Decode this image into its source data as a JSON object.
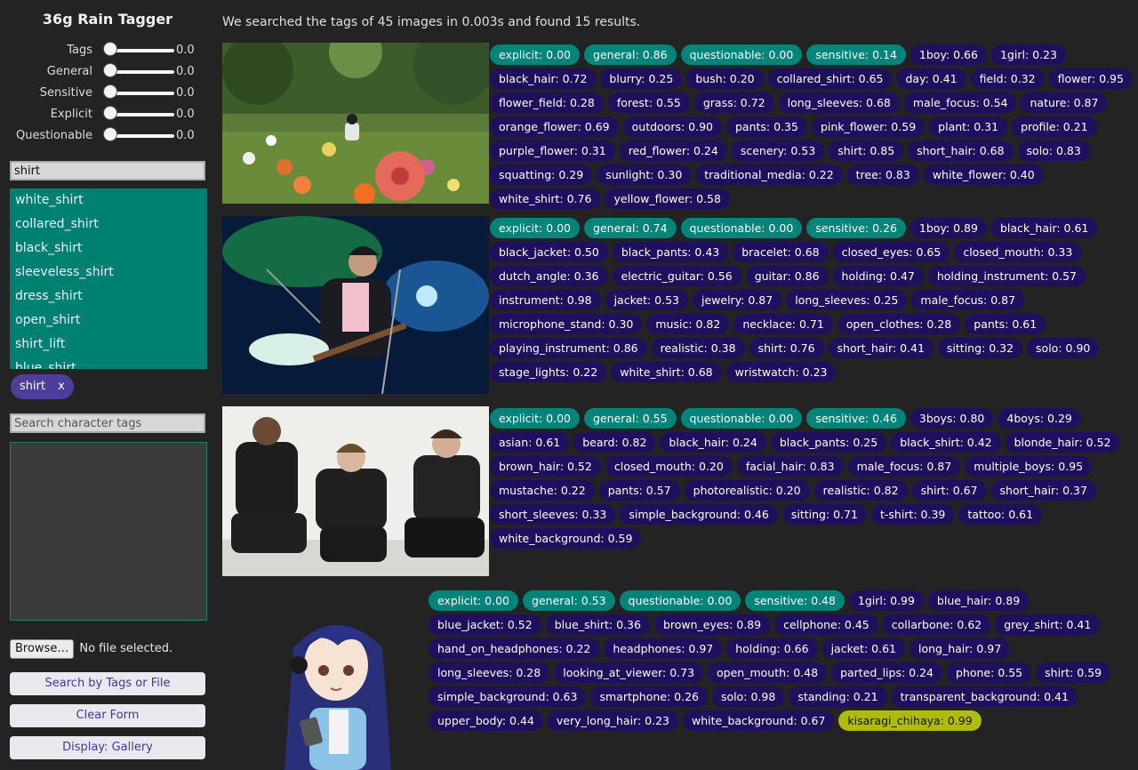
{
  "app": {
    "title": "36g Rain Tagger"
  },
  "sliders": [
    {
      "label": "Tags",
      "value": "0.0"
    },
    {
      "label": "General",
      "value": "0.0"
    },
    {
      "label": "Sensitive",
      "value": "0.0"
    },
    {
      "label": "Explicit",
      "value": "0.0"
    },
    {
      "label": "Questionable",
      "value": "0.0"
    }
  ],
  "search": {
    "value": "shirt"
  },
  "suggestions": [
    "white_shirt",
    "collared_shirt",
    "black_shirt",
    "sleeveless_shirt",
    "dress_shirt",
    "open_shirt",
    "shirt_lift",
    "blue_shirt"
  ],
  "selected_tags": [
    {
      "label": "shirt",
      "remove": "x"
    }
  ],
  "character_search": {
    "placeholder": "Search character tags"
  },
  "file": {
    "button": "Browse…",
    "status": "No file selected."
  },
  "buttons": {
    "search": "Search by Tags or File",
    "clear": "Clear Form",
    "display": "Display: Gallery"
  },
  "results_summary": "We searched the tags of 45 images in 0.003s and found 15 results.",
  "colors": {
    "rating_tag": "#01857a",
    "general_tag": "#1f0f5e",
    "character_tag": "#afbb05",
    "suggest_bg": "#008070",
    "chip_bg": "#4e3d9a"
  },
  "results": [
    {
      "image": "anime-flower-field-scene",
      "tags": [
        {
          "t": "explicit: 0.00",
          "k": "rating"
        },
        {
          "t": "general: 0.86",
          "k": "rating"
        },
        {
          "t": "questionable: 0.00",
          "k": "rating"
        },
        {
          "t": "sensitive: 0.14",
          "k": "rating"
        },
        {
          "t": "1boy: 0.66",
          "k": "general"
        },
        {
          "t": "1girl: 0.23",
          "k": "general"
        },
        {
          "t": "black_hair: 0.72",
          "k": "general"
        },
        {
          "t": "blurry: 0.25",
          "k": "general"
        },
        {
          "t": "bush: 0.20",
          "k": "general"
        },
        {
          "t": "collared_shirt: 0.65",
          "k": "general"
        },
        {
          "t": "day: 0.41",
          "k": "general"
        },
        {
          "t": "field: 0.32",
          "k": "general"
        },
        {
          "t": "flower: 0.95",
          "k": "general"
        },
        {
          "t": "flower_field: 0.28",
          "k": "general"
        },
        {
          "t": "forest: 0.55",
          "k": "general"
        },
        {
          "t": "grass: 0.72",
          "k": "general"
        },
        {
          "t": "long_sleeves: 0.68",
          "k": "general"
        },
        {
          "t": "male_focus: 0.54",
          "k": "general"
        },
        {
          "t": "nature: 0.87",
          "k": "general"
        },
        {
          "t": "orange_flower: 0.69",
          "k": "general"
        },
        {
          "t": "outdoors: 0.90",
          "k": "general"
        },
        {
          "t": "pants: 0.35",
          "k": "general"
        },
        {
          "t": "pink_flower: 0.59",
          "k": "general"
        },
        {
          "t": "plant: 0.31",
          "k": "general"
        },
        {
          "t": "profile: 0.21",
          "k": "general"
        },
        {
          "t": "purple_flower: 0.31",
          "k": "general"
        },
        {
          "t": "red_flower: 0.24",
          "k": "general"
        },
        {
          "t": "scenery: 0.53",
          "k": "general"
        },
        {
          "t": "shirt: 0.85",
          "k": "general"
        },
        {
          "t": "short_hair: 0.68",
          "k": "general"
        },
        {
          "t": "solo: 0.83",
          "k": "general"
        },
        {
          "t": "squatting: 0.29",
          "k": "general"
        },
        {
          "t": "sunlight: 0.30",
          "k": "general"
        },
        {
          "t": "traditional_media: 0.22",
          "k": "general"
        },
        {
          "t": "tree: 0.83",
          "k": "general"
        },
        {
          "t": "white_flower: 0.40",
          "k": "general"
        },
        {
          "t": "white_shirt: 0.76",
          "k": "general"
        },
        {
          "t": "yellow_flower: 0.58",
          "k": "general"
        }
      ]
    },
    {
      "image": "guitarist-on-stage-photo",
      "tags": [
        {
          "t": "explicit: 0.00",
          "k": "rating"
        },
        {
          "t": "general: 0.74",
          "k": "rating"
        },
        {
          "t": "questionable: 0.00",
          "k": "rating"
        },
        {
          "t": "sensitive: 0.26",
          "k": "rating"
        },
        {
          "t": "1boy: 0.89",
          "k": "general"
        },
        {
          "t": "black_hair: 0.61",
          "k": "general"
        },
        {
          "t": "black_jacket: 0.50",
          "k": "general"
        },
        {
          "t": "black_pants: 0.43",
          "k": "general"
        },
        {
          "t": "bracelet: 0.68",
          "k": "general"
        },
        {
          "t": "closed_eyes: 0.65",
          "k": "general"
        },
        {
          "t": "closed_mouth: 0.33",
          "k": "general"
        },
        {
          "t": "dutch_angle: 0.36",
          "k": "general"
        },
        {
          "t": "electric_guitar: 0.56",
          "k": "general"
        },
        {
          "t": "guitar: 0.86",
          "k": "general"
        },
        {
          "t": "holding: 0.47",
          "k": "general"
        },
        {
          "t": "holding_instrument: 0.57",
          "k": "general"
        },
        {
          "t": "instrument: 0.98",
          "k": "general"
        },
        {
          "t": "jacket: 0.53",
          "k": "general"
        },
        {
          "t": "jewelry: 0.87",
          "k": "general"
        },
        {
          "t": "long_sleeves: 0.25",
          "k": "general"
        },
        {
          "t": "male_focus: 0.87",
          "k": "general"
        },
        {
          "t": "microphone_stand: 0.30",
          "k": "general"
        },
        {
          "t": "music: 0.82",
          "k": "general"
        },
        {
          "t": "necklace: 0.71",
          "k": "general"
        },
        {
          "t": "open_clothes: 0.28",
          "k": "general"
        },
        {
          "t": "pants: 0.61",
          "k": "general"
        },
        {
          "t": "playing_instrument: 0.86",
          "k": "general"
        },
        {
          "t": "realistic: 0.38",
          "k": "general"
        },
        {
          "t": "shirt: 0.76",
          "k": "general"
        },
        {
          "t": "short_hair: 0.41",
          "k": "general"
        },
        {
          "t": "sitting: 0.32",
          "k": "general"
        },
        {
          "t": "solo: 0.90",
          "k": "general"
        },
        {
          "t": "stage_lights: 0.22",
          "k": "general"
        },
        {
          "t": "white_shirt: 0.68",
          "k": "general"
        },
        {
          "t": "wristwatch: 0.23",
          "k": "general"
        }
      ]
    },
    {
      "image": "three-men-sitting-photo",
      "tags": [
        {
          "t": "explicit: 0.00",
          "k": "rating"
        },
        {
          "t": "general: 0.55",
          "k": "rating"
        },
        {
          "t": "questionable: 0.00",
          "k": "rating"
        },
        {
          "t": "sensitive: 0.46",
          "k": "rating"
        },
        {
          "t": "3boys: 0.80",
          "k": "general"
        },
        {
          "t": "4boys: 0.29",
          "k": "general"
        },
        {
          "t": "asian: 0.61",
          "k": "general"
        },
        {
          "t": "beard: 0.82",
          "k": "general"
        },
        {
          "t": "black_hair: 0.24",
          "k": "general"
        },
        {
          "t": "black_pants: 0.25",
          "k": "general"
        },
        {
          "t": "black_shirt: 0.42",
          "k": "general"
        },
        {
          "t": "blonde_hair: 0.52",
          "k": "general"
        },
        {
          "t": "brown_hair: 0.52",
          "k": "general"
        },
        {
          "t": "closed_mouth: 0.20",
          "k": "general"
        },
        {
          "t": "facial_hair: 0.83",
          "k": "general"
        },
        {
          "t": "male_focus: 0.87",
          "k": "general"
        },
        {
          "t": "multiple_boys: 0.95",
          "k": "general"
        },
        {
          "t": "mustache: 0.22",
          "k": "general"
        },
        {
          "t": "pants: 0.57",
          "k": "general"
        },
        {
          "t": "photorealistic: 0.20",
          "k": "general"
        },
        {
          "t": "realistic: 0.82",
          "k": "general"
        },
        {
          "t": "shirt: 0.67",
          "k": "general"
        },
        {
          "t": "short_hair: 0.37",
          "k": "general"
        },
        {
          "t": "short_sleeves: 0.33",
          "k": "general"
        },
        {
          "t": "simple_background: 0.46",
          "k": "general"
        },
        {
          "t": "sitting: 0.71",
          "k": "general"
        },
        {
          "t": "t-shirt: 0.39",
          "k": "general"
        },
        {
          "t": "tattoo: 0.61",
          "k": "general"
        },
        {
          "t": "white_background: 0.59",
          "k": "general"
        }
      ]
    },
    {
      "image": "anime-girl-with-headphones",
      "tags": [
        {
          "t": "explicit: 0.00",
          "k": "rating"
        },
        {
          "t": "general: 0.53",
          "k": "rating"
        },
        {
          "t": "questionable: 0.00",
          "k": "rating"
        },
        {
          "t": "sensitive: 0.48",
          "k": "rating"
        },
        {
          "t": "1girl: 0.99",
          "k": "general"
        },
        {
          "t": "blue_hair: 0.89",
          "k": "general"
        },
        {
          "t": "blue_jacket: 0.52",
          "k": "general"
        },
        {
          "t": "blue_shirt: 0.36",
          "k": "general"
        },
        {
          "t": "brown_eyes: 0.89",
          "k": "general"
        },
        {
          "t": "cellphone: 0.45",
          "k": "general"
        },
        {
          "t": "collarbone: 0.62",
          "k": "general"
        },
        {
          "t": "grey_shirt: 0.41",
          "k": "general"
        },
        {
          "t": "hand_on_headphones: 0.22",
          "k": "general"
        },
        {
          "t": "headphones: 0.97",
          "k": "general"
        },
        {
          "t": "holding: 0.66",
          "k": "general"
        },
        {
          "t": "jacket: 0.61",
          "k": "general"
        },
        {
          "t": "long_hair: 0.97",
          "k": "general"
        },
        {
          "t": "long_sleeves: 0.28",
          "k": "general"
        },
        {
          "t": "looking_at_viewer: 0.73",
          "k": "general"
        },
        {
          "t": "open_mouth: 0.48",
          "k": "general"
        },
        {
          "t": "parted_lips: 0.24",
          "k": "general"
        },
        {
          "t": "phone: 0.55",
          "k": "general"
        },
        {
          "t": "shirt: 0.59",
          "k": "general"
        },
        {
          "t": "simple_background: 0.63",
          "k": "general"
        },
        {
          "t": "smartphone: 0.26",
          "k": "general"
        },
        {
          "t": "solo: 0.98",
          "k": "general"
        },
        {
          "t": "standing: 0.21",
          "k": "general"
        },
        {
          "t": "transparent_background: 0.41",
          "k": "general"
        },
        {
          "t": "upper_body: 0.44",
          "k": "general"
        },
        {
          "t": "very_long_hair: 0.23",
          "k": "general"
        },
        {
          "t": "white_background: 0.67",
          "k": "general"
        },
        {
          "t": "kisaragi_chihaya: 0.99",
          "k": "character"
        }
      ]
    }
  ]
}
